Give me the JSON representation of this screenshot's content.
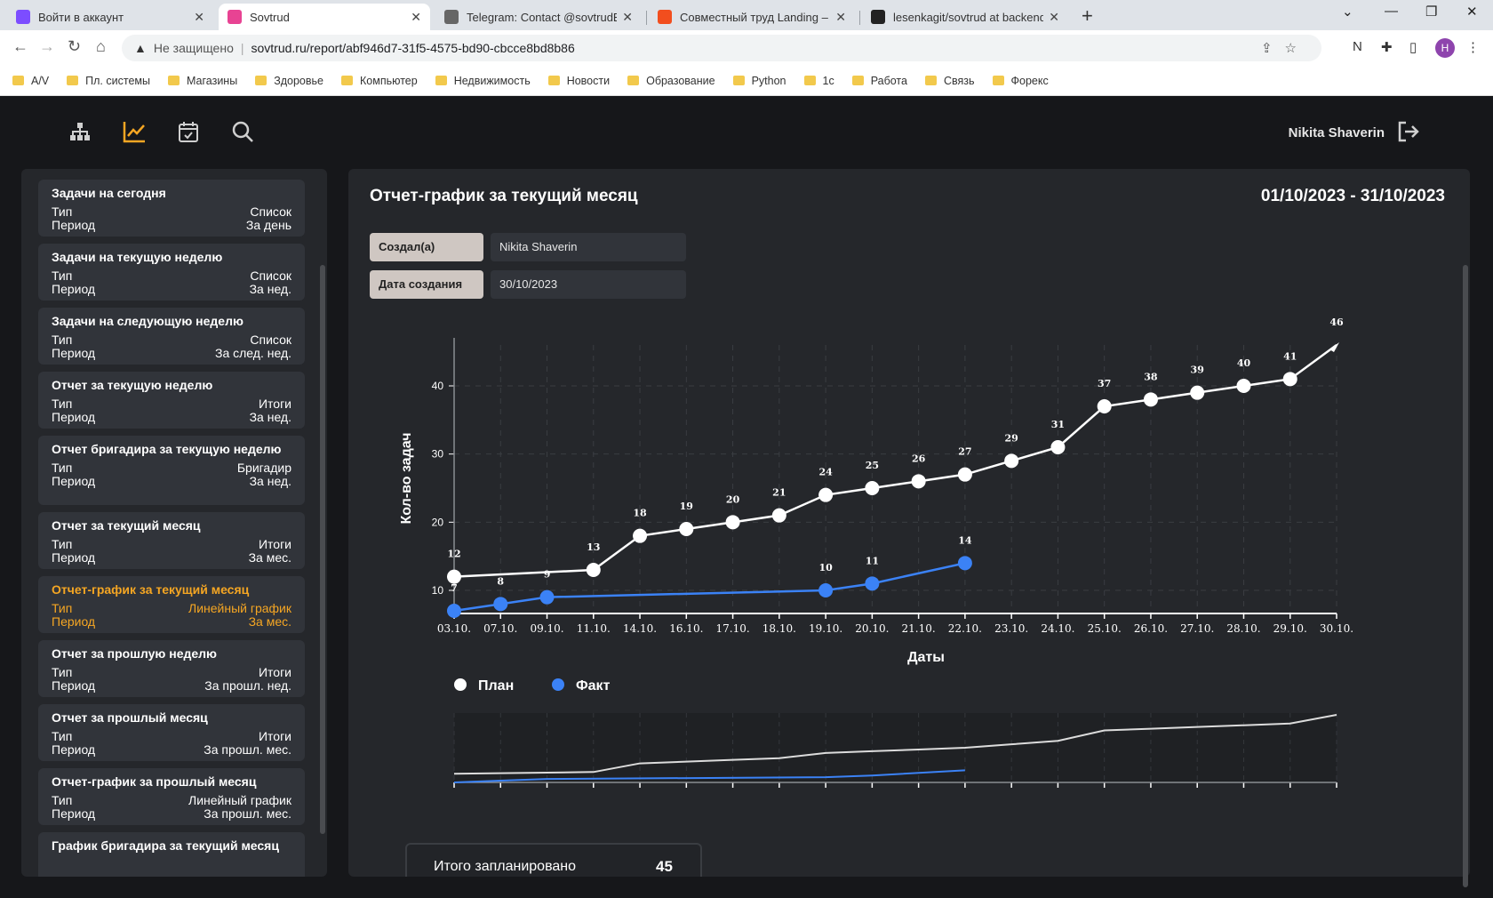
{
  "browser": {
    "tabs": [
      {
        "label": "Войти в аккаунт",
        "favicon_color": "#7c4dff"
      },
      {
        "label": "Sovtrud",
        "favicon_color": "#e84393"
      },
      {
        "label": "Telegram: Contact @sovtrudBot",
        "favicon_color": "#666666"
      },
      {
        "label": "Совместный труд Landing – Fig",
        "favicon_color": "#f24e1e"
      },
      {
        "label": "lesenkagit/sovtrud at backend-d",
        "favicon_color": "#222222"
      }
    ],
    "new_tab": "+",
    "address": {
      "security_text": "Не защищено",
      "url": "sovtrud.ru/report/abf946d7-31f5-4575-bd90-cbcce8bd8b86"
    },
    "profile_initial": "H",
    "bookmarks": [
      "A/V",
      "Пл. системы",
      "Магазины",
      "Здоровье",
      "Компьютер",
      "Недвижимость",
      "Новости",
      "Образование",
      "Python",
      "1с",
      "Работа",
      "Связь",
      "Форекс"
    ]
  },
  "app": {
    "user_name": "Nikita Shaverin",
    "nav_icons": [
      "hierarchy-icon",
      "chart-line-icon",
      "calendar-icon",
      "search-icon"
    ],
    "accent_color": "#f5a623",
    "sidebar": [
      {
        "title": "Задачи на сегодня",
        "type_label": "Тип",
        "type_value": "Список",
        "period_label": "Период",
        "period_value": "За день",
        "active": false
      },
      {
        "title": "Задачи на текущую неделю",
        "type_label": "Тип",
        "type_value": "Список",
        "period_label": "Период",
        "period_value": "За нед.",
        "active": false
      },
      {
        "title": "Задачи на следующую неделю",
        "type_label": "Тип",
        "type_value": "Список",
        "period_label": "Период",
        "period_value": "За след. нед.",
        "active": false
      },
      {
        "title": "Отчет за текущую неделю",
        "type_label": "Тип",
        "type_value": "Итоги",
        "period_label": "Период",
        "period_value": "За нед.",
        "active": false
      },
      {
        "title": "Отчет бригадира за текущую неделю",
        "type_label": "Тип",
        "type_value": "Бригадир",
        "period_label": "Период",
        "period_value": "За нед.",
        "active": false
      },
      {
        "title": "Отчет за текущий месяц",
        "type_label": "Тип",
        "type_value": "Итоги",
        "period_label": "Период",
        "period_value": "За мес.",
        "active": false
      },
      {
        "title": "Отчет-график за текущий месяц",
        "type_label": "Тип",
        "type_value": "Линейный график",
        "period_label": "Период",
        "period_value": "За мес.",
        "active": true
      },
      {
        "title": "Отчет за прошлую неделю",
        "type_label": "Тип",
        "type_value": "Итоги",
        "period_label": "Период",
        "period_value": "За прошл. нед.",
        "active": false
      },
      {
        "title": "Отчет за прошлый месяц",
        "type_label": "Тип",
        "type_value": "Итоги",
        "period_label": "Период",
        "period_value": "За прошл. мес.",
        "active": false
      },
      {
        "title": "Отчет-график за прошлый месяц",
        "type_label": "Тип",
        "type_value": "Линейный график",
        "period_label": "Период",
        "period_value": "За прошл. мес.",
        "active": false
      },
      {
        "title": "График бригадира за текущий месяц",
        "type_label": "",
        "type_value": "",
        "period_label": "",
        "period_value": "",
        "active": false
      }
    ],
    "report": {
      "title": "Отчет-график за текущий месяц",
      "period": "01/10/2023 - 31/10/2023",
      "created_by_label": "Создал(а)",
      "created_by_value": "Nikita Shaverin",
      "created_date_label": "Дата создания",
      "created_date_value": "30/10/2023",
      "total_label": "Итого запланировано",
      "total_value": "45"
    }
  },
  "chart_data": {
    "type": "line",
    "title": "",
    "xlabel": "Даты",
    "ylabel": "Кол-во задач",
    "ylim": [
      7,
      46
    ],
    "yticks": [
      10,
      20,
      30,
      40
    ],
    "grid": true,
    "legend_placement": "bottom-left",
    "range_slider": true,
    "categories": [
      "03.10.",
      "07.10.",
      "09.10.",
      "11.10.",
      "14.10.",
      "16.10.",
      "17.10.",
      "18.10.",
      "19.10.",
      "20.10.",
      "21.10.",
      "22.10.",
      "23.10.",
      "24.10.",
      "25.10.",
      "26.10.",
      "27.10.",
      "28.10.",
      "29.10.",
      "30.10."
    ],
    "series": [
      {
        "name": "План",
        "color": "#ffffff",
        "values": [
          12,
          null,
          null,
          13,
          18,
          19,
          20,
          21,
          24,
          25,
          26,
          27,
          29,
          31,
          37,
          38,
          39,
          40,
          41,
          46
        ]
      },
      {
        "name": "Факт",
        "color": "#3b82f6",
        "values": [
          7,
          8,
          9,
          null,
          null,
          null,
          null,
          null,
          10,
          11,
          null,
          14,
          null,
          null,
          null,
          null,
          null,
          null,
          null,
          null
        ]
      }
    ]
  }
}
